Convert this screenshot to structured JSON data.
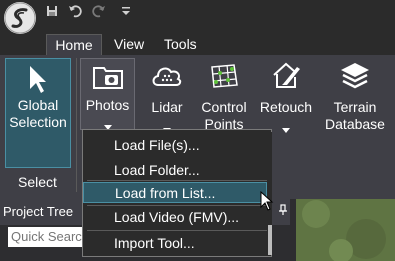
{
  "menu_tabs": [
    "Home",
    "View",
    "Tools"
  ],
  "ribbon": {
    "global_selection": "Global\nSelection",
    "photos": "Photos",
    "lidar": "Lidar",
    "control_points": "Control\nPoints",
    "retouch": "Retouch",
    "terrain_database": "Terrain\nDatabase",
    "select_group": "Select"
  },
  "panel": {
    "project_tree_title": "Project Tree",
    "search_placeholder": "Quick Search"
  },
  "dropdown": {
    "items": [
      "Load File(s)...",
      "Load Folder...",
      "Load from List...",
      "Load Video (FMV)...",
      "Import Tool..."
    ],
    "hovered_index": 2
  },
  "colors": {
    "accent": "#2f5a68",
    "accent_border": "#4a8fa3",
    "ribbon_bg": "#3f3f46",
    "titlebar_bg": "#2b2b2b"
  }
}
